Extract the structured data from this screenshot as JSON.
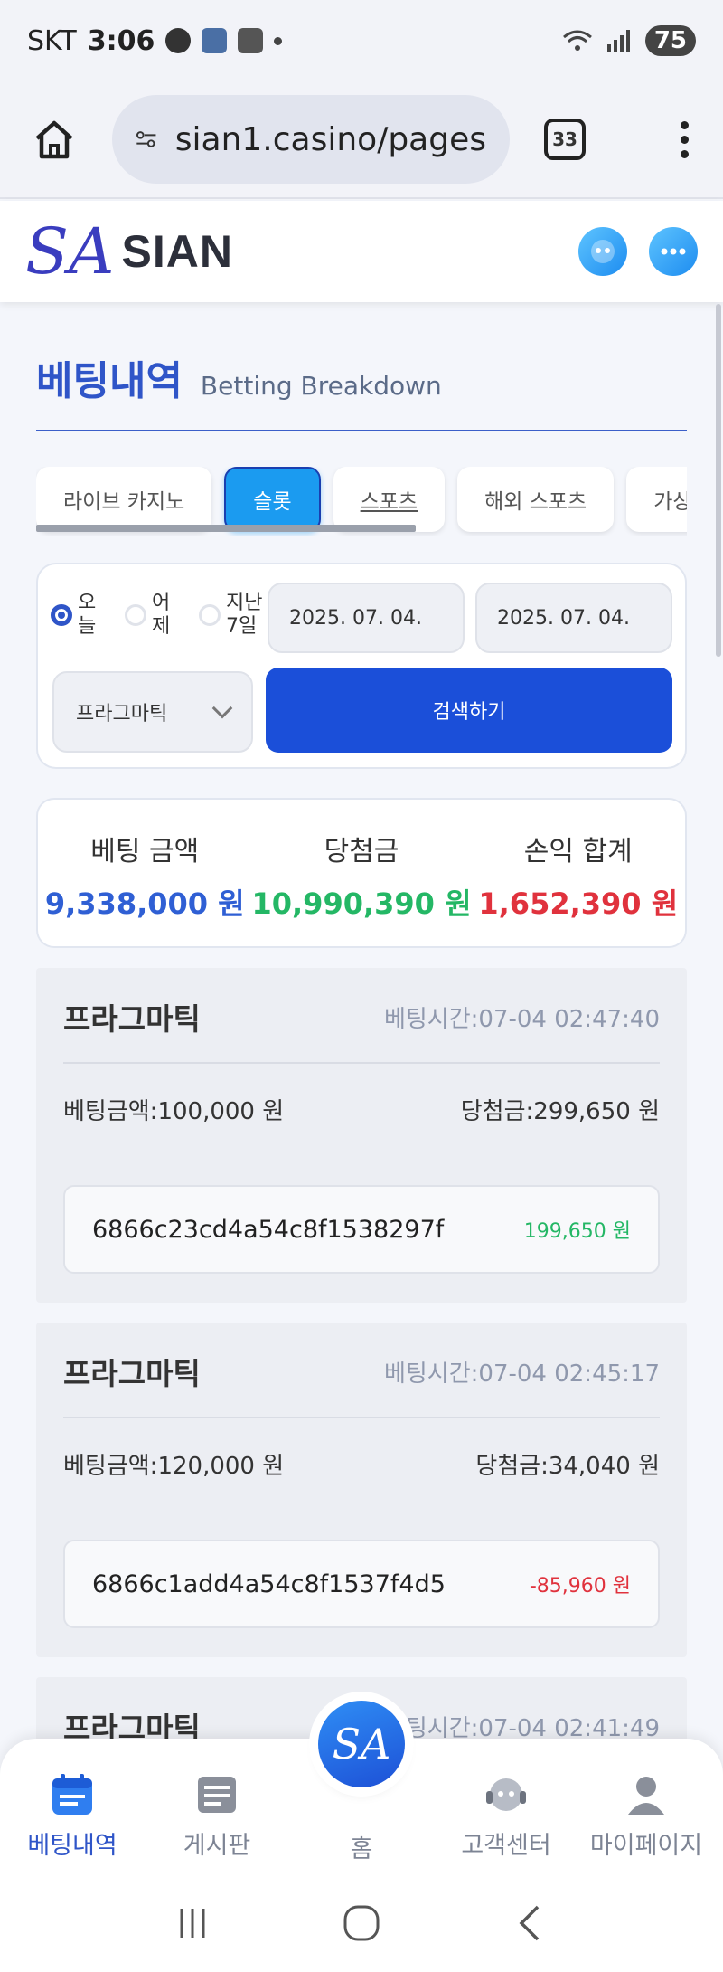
{
  "status_bar": {
    "carrier": "SKT",
    "time": "3:06",
    "battery": "75"
  },
  "browser": {
    "url": "sian1.casino/pages",
    "tab_count": "33"
  },
  "site": {
    "logo_text": "SIAN"
  },
  "page": {
    "title_ko": "베팅내역",
    "title_en": "Betting Breakdown"
  },
  "tabs": [
    {
      "label": "라이브 카지노"
    },
    {
      "label": "슬롯"
    },
    {
      "label": "스포츠"
    },
    {
      "label": "해외 스포츠"
    },
    {
      "label": "가상"
    }
  ],
  "filter": {
    "radios": [
      {
        "label": "오늘",
        "checked": true
      },
      {
        "label": "어제",
        "checked": false
      },
      {
        "label": "지난 7일",
        "checked": false
      }
    ],
    "date_from": "2025. 07. 04.",
    "date_to": "2025. 07. 04.",
    "provider": "프라그마틱",
    "search_label": "검색하기"
  },
  "summary": {
    "bet_label": "베팅 금액",
    "bet_value": "9,338,000 원",
    "win_label": "당첨금",
    "win_value": "10,990,390 원",
    "pl_label": "손익 합계",
    "pl_value": "1,652,390 원"
  },
  "records": [
    {
      "provider": "프라그마틱",
      "time": "베팅시간:07-04 02:47:40",
      "bet": "베팅금액:100,000 원",
      "win": "당첨금:299,650 원",
      "id": "6866c23cd4a54c8f1538297f",
      "diff": "199,650 원"
    },
    {
      "provider": "프라그마틱",
      "time": "베팅시간:07-04 02:45:17",
      "bet": "베팅금액:120,000 원",
      "win": "당첨금:34,040 원",
      "id": "6866c1add4a54c8f1537f4d5",
      "diff": "-85,960 원"
    },
    {
      "provider": "프라그마틱",
      "time": "베팅시간:07-04 02:41:49"
    }
  ],
  "bottom_nav": {
    "betting": "베팅내역",
    "board": "게시판",
    "home": "홈",
    "support": "고객센터",
    "mypage": "마이페이지"
  },
  "colors": {
    "accent": "#2f55c8",
    "positive": "#24b765",
    "negative": "#e0323d",
    "active_tab": "#1b9bf0",
    "button": "#1b4fd9"
  }
}
